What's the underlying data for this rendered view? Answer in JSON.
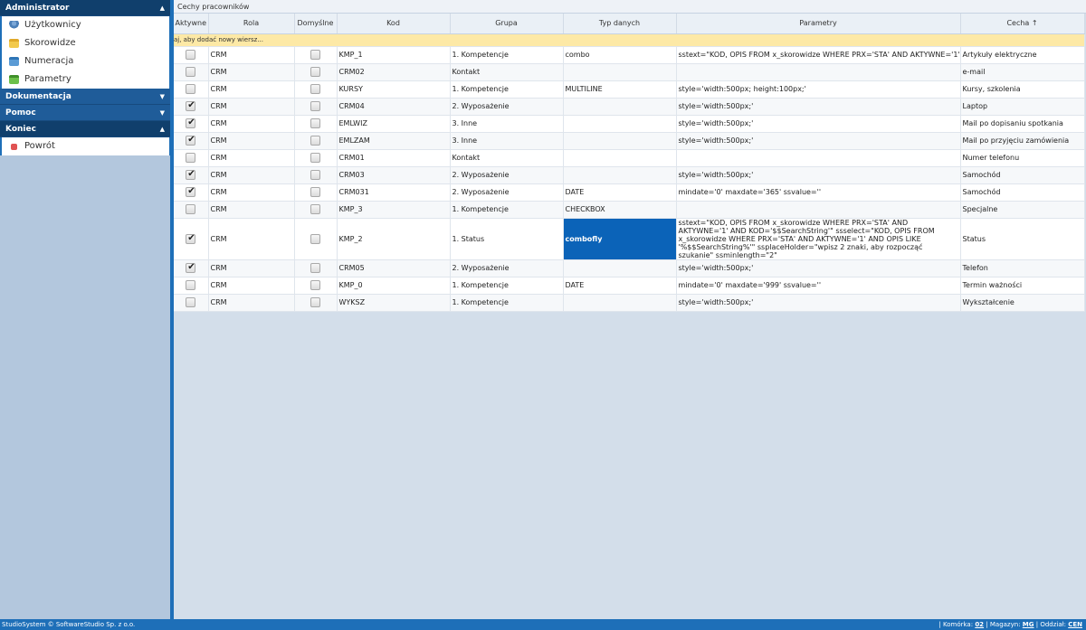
{
  "sidebar": {
    "sections": [
      {
        "title": "Administrator",
        "expanded": true,
        "active": true,
        "items": [
          {
            "label": "Użytkownicy",
            "icon": "users-icon"
          },
          {
            "label": "Skorowidze",
            "icon": "folder-icon"
          },
          {
            "label": "Numeracja",
            "icon": "numbering-icon"
          },
          {
            "label": "Parametry",
            "icon": "parameters-icon"
          }
        ]
      },
      {
        "title": "Dokumentacja",
        "expanded": false
      },
      {
        "title": "Pomoc",
        "expanded": false
      },
      {
        "title": "Koniec",
        "expanded": true,
        "active": true,
        "items": [
          {
            "label": "Powrót",
            "icon": "back-icon"
          }
        ]
      }
    ]
  },
  "grid": {
    "title": "Cechy pracowników",
    "columns": [
      "Aktywne",
      "Rola",
      "Domyślne",
      "Kod",
      "Grupa",
      "Typ danych",
      "Parametry",
      "Cecha ↑"
    ],
    "new_row_hint": "aj, aby dodać nowy wiersz...",
    "rows": [
      {
        "aktywne": false,
        "rola": "CRM",
        "domyslne": false,
        "kod": "KMP_1",
        "grupa": "1. Kompetencje",
        "typ": "combo",
        "param": "sstext=\"KOD, OPIS FROM x_skorowidze WHERE PRX='STA' AND AKTYWNE='1'\"",
        "cecha": "Artykuły elektryczne"
      },
      {
        "aktywne": false,
        "rola": "CRM",
        "domyslne": false,
        "kod": "CRM02",
        "grupa": "Kontakt",
        "typ": "",
        "param": "",
        "cecha": "e-mail"
      },
      {
        "aktywne": false,
        "rola": "CRM",
        "domyslne": false,
        "kod": "KURSY",
        "grupa": "1. Kompetencje",
        "typ": "MULTILINE",
        "param": "style='width:500px; height:100px;'",
        "cecha": "Kursy, szkolenia"
      },
      {
        "aktywne": true,
        "rola": "CRM",
        "domyslne": false,
        "kod": "CRM04",
        "grupa": "2. Wyposażenie",
        "typ": "",
        "param": "style='width:500px;'",
        "cecha": "Laptop"
      },
      {
        "aktywne": true,
        "rola": "CRM",
        "domyslne": false,
        "kod": "EMLWIZ",
        "grupa": "3. Inne",
        "typ": "",
        "param": "style='width:500px;'",
        "cecha": "Mail po dopisaniu spotkania"
      },
      {
        "aktywne": true,
        "rola": "CRM",
        "domyslne": false,
        "kod": "EMLZAM",
        "grupa": "3. Inne",
        "typ": "",
        "param": "style='width:500px;'",
        "cecha": "Mail po przyjęciu zamówienia"
      },
      {
        "aktywne": false,
        "rola": "CRM",
        "domyslne": false,
        "kod": "CRM01",
        "grupa": "Kontakt",
        "typ": "",
        "param": "",
        "cecha": "Numer telefonu"
      },
      {
        "aktywne": true,
        "rola": "CRM",
        "domyslne": false,
        "kod": "CRM03",
        "grupa": "2. Wyposażenie",
        "typ": "",
        "param": "style='width:500px;'",
        "cecha": "Samochód"
      },
      {
        "aktywne": true,
        "rola": "CRM",
        "domyslne": false,
        "kod": "CRM031",
        "grupa": "2. Wyposażenie",
        "typ": "DATE",
        "param": "mindate='0' maxdate='365' ssvalue=''",
        "cecha": "Samochód"
      },
      {
        "aktywne": false,
        "rola": "CRM",
        "domyslne": false,
        "kod": "KMP_3",
        "grupa": "1. Kompetencje",
        "typ": "CHECKBOX",
        "param": "",
        "cecha": "Specjalne"
      },
      {
        "aktywne": true,
        "rola": "CRM",
        "domyslne": false,
        "kod": "KMP_2",
        "grupa": "1. Status",
        "typ": "combofly",
        "selected_cell": true,
        "multiline": true,
        "param": "sstext=\"KOD, OPIS FROM x_skorowidze WHERE PRX='STA' AND AKTYWNE='1' AND KOD='$$SearchString'\" ssselect=\"KOD, OPIS FROM x_skorowidze WHERE PRX='STA' AND AKTYWNE='1' AND OPIS LIKE '%$$SearchString%'\" ssplaceHolder=\"wpisz 2 znaki, aby rozpocząć szukanie\" ssminlength=\"2\"",
        "cecha": "Status"
      },
      {
        "aktywne": true,
        "rola": "CRM",
        "domyslne": false,
        "kod": "CRM05",
        "grupa": "2. Wyposażenie",
        "typ": "",
        "param": "style='width:500px;'",
        "cecha": "Telefon"
      },
      {
        "aktywne": false,
        "rola": "CRM",
        "domyslne": false,
        "kod": "KMP_0",
        "grupa": "1. Kompetencje",
        "typ": "DATE",
        "param": "mindate='0' maxdate='999' ssvalue=''",
        "cecha": "Termin ważności"
      },
      {
        "aktywne": false,
        "rola": "CRM",
        "domyslne": false,
        "kod": "WYKSZ",
        "grupa": "1. Kompetencje",
        "typ": "",
        "param": "style='width:500px;'",
        "cecha": "Wykształcenie"
      }
    ]
  },
  "statusbar": {
    "copyright": "StudioSystem © SoftwareStudio Sp. z o.o.",
    "komorka_label": "Komórka:",
    "komorka_value": "02",
    "magazyn_label": "Magazyn:",
    "magazyn_value": "MG",
    "oddzial_label": "Oddział:",
    "oddzial_value": "CEN"
  },
  "colors": {
    "accent": "#1e6fb8",
    "sidebar_header": "#1f5c99",
    "selected_cell": "#0b63b8",
    "new_row": "#fde9a6"
  }
}
